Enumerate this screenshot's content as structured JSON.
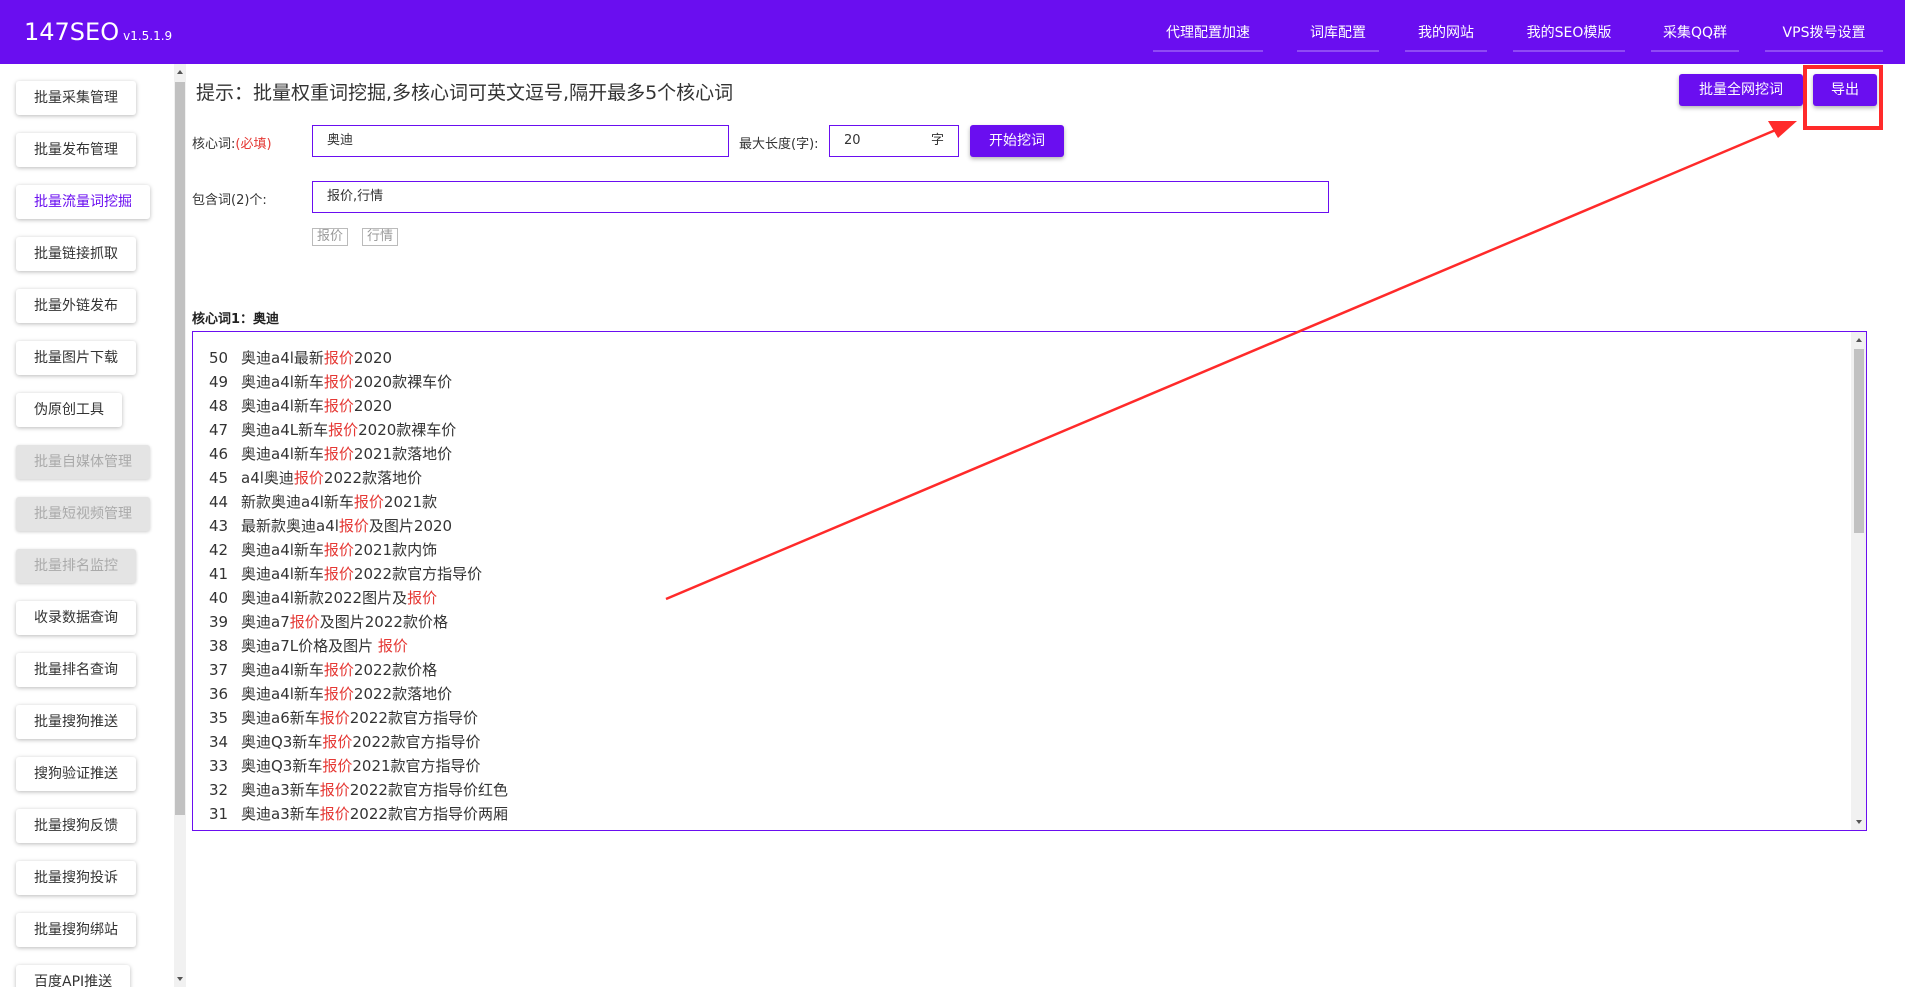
{
  "app": {
    "brand": "147SEO",
    "version": "v1.5.1.9"
  },
  "nav": [
    {
      "label": "代理配置加速"
    },
    {
      "label": "词库配置"
    },
    {
      "label": "我的网站"
    },
    {
      "label": "我的SEO模版"
    },
    {
      "label": "采集QQ群"
    },
    {
      "label": "VPS拨号设置"
    }
  ],
  "sidebar": [
    {
      "label": "批量采集管理"
    },
    {
      "label": "批量发布管理"
    },
    {
      "label": "批量流量词挖掘",
      "state": "active"
    },
    {
      "label": "批量链接抓取"
    },
    {
      "label": "批量外链发布"
    },
    {
      "label": "批量图片下载"
    },
    {
      "label": "伪原创工具"
    },
    {
      "label": "批量自媒体管理",
      "state": "disabled"
    },
    {
      "label": "批量短视频管理",
      "state": "disabled"
    },
    {
      "label": "批量排名监控",
      "state": "disabled"
    },
    {
      "label": "收录数据查询"
    },
    {
      "label": "批量排名查询"
    },
    {
      "label": "批量搜狗推送"
    },
    {
      "label": "搜狗验证推送"
    },
    {
      "label": "批量搜狗反馈"
    },
    {
      "label": "批量搜狗投诉"
    },
    {
      "label": "批量搜狗绑站"
    },
    {
      "label": "百度API推送"
    }
  ],
  "main": {
    "tip": "提示：批量权重词挖掘,多核心词可英文逗号,隔开最多5个核心词",
    "btn_all_web": "批量全网挖词",
    "btn_export": "导出",
    "core_label": "核心词:",
    "core_required": "(必填)",
    "core_value": "奥迪",
    "maxlen_label": "最大长度(字):",
    "maxlen_value": "20",
    "maxlen_unit": "字",
    "btn_start": "开始挖词",
    "include_label": "包含词(2)个:",
    "include_value": "报价,行情",
    "tags": [
      "报价",
      "行情"
    ],
    "section_title": "核心词1：奥迪"
  },
  "results": [
    {
      "num": "50",
      "pre": "奥迪a4l最新",
      "hl": "报价",
      "post": "2020"
    },
    {
      "num": "49",
      "pre": "奥迪a4l新车",
      "hl": "报价",
      "post": "2020款裸车价"
    },
    {
      "num": "48",
      "pre": "奥迪a4l新车",
      "hl": "报价",
      "post": "2020"
    },
    {
      "num": "47",
      "pre": "奥迪a4L新车",
      "hl": "报价",
      "post": "2020款裸车价"
    },
    {
      "num": "46",
      "pre": "奥迪a4l新车",
      "hl": "报价",
      "post": "2021款落地价"
    },
    {
      "num": "45",
      "pre": "a4l奥迪",
      "hl": "报价",
      "post": "2022款落地价"
    },
    {
      "num": "44",
      "pre": "新款奥迪a4l新车",
      "hl": "报价",
      "post": "2021款"
    },
    {
      "num": "43",
      "pre": "最新款奥迪a4l",
      "hl": "报价",
      "post": "及图片2020"
    },
    {
      "num": "42",
      "pre": "奥迪a4l新车",
      "hl": "报价",
      "post": "2021款内饰"
    },
    {
      "num": "41",
      "pre": "奥迪a4l新车",
      "hl": "报价",
      "post": "2022款官方指导价"
    },
    {
      "num": "40",
      "pre": "奥迪a4l新款2022图片及",
      "hl": "报价",
      "post": ""
    },
    {
      "num": "39",
      "pre": "奥迪a7",
      "hl": "报价",
      "post": "及图片2022款价格"
    },
    {
      "num": "38",
      "pre": "奥迪a7L价格及图片 ",
      "hl": "报价",
      "post": ""
    },
    {
      "num": "37",
      "pre": "奥迪a4l新车",
      "hl": "报价",
      "post": "2022款价格"
    },
    {
      "num": "36",
      "pre": "奥迪a4l新车",
      "hl": "报价",
      "post": "2022款落地价"
    },
    {
      "num": "35",
      "pre": "奥迪a6新车",
      "hl": "报价",
      "post": "2022款官方指导价"
    },
    {
      "num": "34",
      "pre": "奥迪Q3新车",
      "hl": "报价",
      "post": "2022款官方指导价"
    },
    {
      "num": "33",
      "pre": "奥迪Q3新车",
      "hl": "报价",
      "post": "2021款官方指导价"
    },
    {
      "num": "32",
      "pre": "奥迪a3新车",
      "hl": "报价",
      "post": "2022款官方指导价红色"
    },
    {
      "num": "31",
      "pre": "奥迪a3新车",
      "hl": "报价",
      "post": "2022款官方指导价两厢"
    }
  ],
  "colors": {
    "primary": "#6a0ef0",
    "highlight": "#e53935",
    "annotation": "#ff2a2a"
  },
  "icons": {
    "scroll_up": "caret-up-icon",
    "scroll_down": "caret-down-icon"
  }
}
